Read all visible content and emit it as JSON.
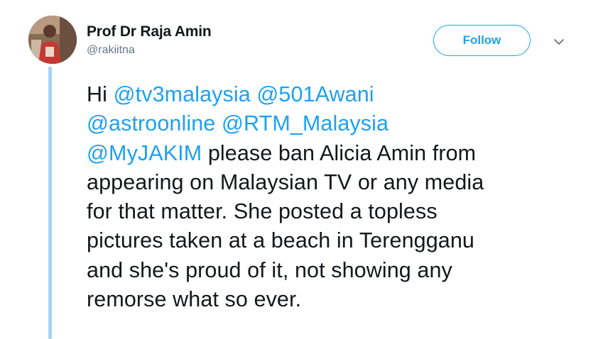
{
  "author": {
    "display_name": "Prof Dr Raja Amin",
    "handle": "@rakiitna"
  },
  "actions": {
    "follow_label": "Follow",
    "caret_icon": "chevron-down-icon"
  },
  "tweet": {
    "lines": [
      {
        "parts": [
          {
            "text": "Hi ",
            "mention": false
          },
          {
            "text": "@tv3malaysia",
            "mention": true
          },
          {
            "text": " ",
            "mention": false
          },
          {
            "text": "@501Awani",
            "mention": true
          }
        ]
      },
      {
        "parts": [
          {
            "text": "@astroonline",
            "mention": true
          },
          {
            "text": " ",
            "mention": false
          },
          {
            "text": "@RTM_Malaysia",
            "mention": true
          }
        ]
      },
      {
        "parts": [
          {
            "text": "@MyJAKIM",
            "mention": true
          },
          {
            "text": " please ban Alicia Amin from",
            "mention": false
          }
        ]
      },
      {
        "parts": [
          {
            "text": "appearing on Malaysian TV or any media",
            "mention": false
          }
        ]
      },
      {
        "parts": [
          {
            "text": "for that matter. She posted a topless",
            "mention": false
          }
        ]
      },
      {
        "parts": [
          {
            "text": "pictures taken at a beach in Terengganu",
            "mention": false
          }
        ]
      },
      {
        "parts": [
          {
            "text": "and she's proud of it, not showing any",
            "mention": false
          }
        ]
      },
      {
        "parts": [
          {
            "text": "remorse what so ever.",
            "mention": false
          }
        ]
      }
    ]
  },
  "colors": {
    "accent": "#1da1f2",
    "text": "#14171a",
    "secondary_text": "#657786",
    "thread_line": "#a6d4f2"
  }
}
